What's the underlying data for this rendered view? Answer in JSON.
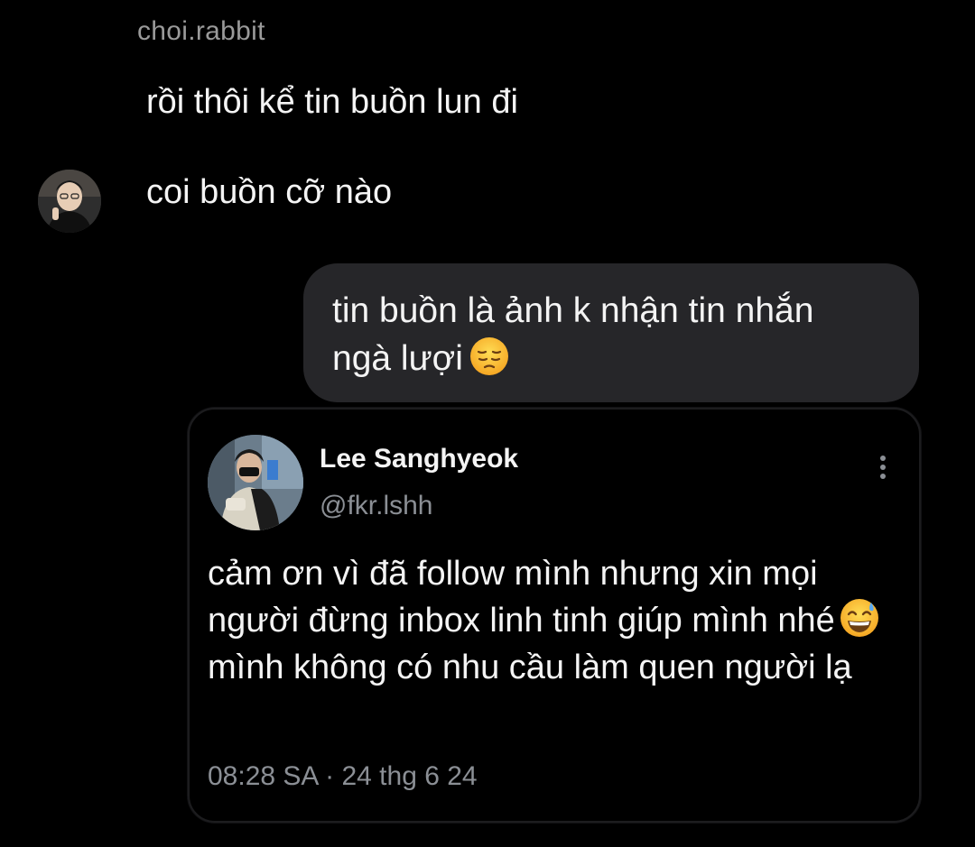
{
  "chat": {
    "sender_name": "choi.rabbit",
    "incoming": [
      "rồi thôi kể tin buồn lun đi",
      "coi buồn cỡ nào"
    ],
    "outgoing": {
      "line1": "tin buồn là ảnh k nhận tin nhắn",
      "line2": "ngà lượi",
      "emoji": "pensive-face"
    }
  },
  "tweet": {
    "name": "Lee Sanghyeok",
    "handle": "@fkr.lshh",
    "body_part1": "cảm ơn vì đã follow mình nhưng xin mọi người đừng inbox linh tinh giúp mình nhé",
    "body_emoji": "grinning-face-with-sweat",
    "body_part2": "mình không có nhu cầu làm quen người lạ",
    "time": "08:28 SA",
    "separator": "·",
    "date": "24 thg 6 24"
  },
  "colors": {
    "background": "#000000",
    "bubble": "#262629",
    "muted_text": "#8b8f95",
    "primary_text": "#f4f4f4"
  }
}
